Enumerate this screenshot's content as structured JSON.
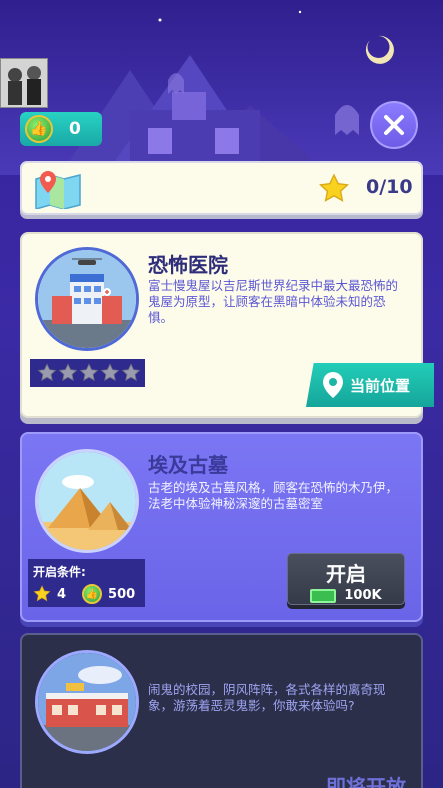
{
  "header": {
    "likes_value": "0",
    "progress_value": "0/10",
    "icons": {
      "likes": "thumbs-up-icon",
      "map": "map-icon",
      "star": "star-icon",
      "close": "close-icon"
    }
  },
  "levels": [
    {
      "title": "恐怖医院",
      "description": "富士慢鬼屋以吉尼斯世界纪录中最大最恐怖的鬼屋为原型，让顾客在黑暗中体验未知的恐惧。",
      "rating_stars": 5,
      "status_label": "当前位置"
    },
    {
      "title": "埃及古墓",
      "description": "古老的埃及古墓风格，顾客在恐怖的木乃伊，法老中体验神秘深邃的古墓密室",
      "unlock_label": "开启条件:",
      "unlock_stars": "4",
      "unlock_likes": "500",
      "open_label": "开启",
      "open_cost": "100K"
    },
    {
      "description": "闹鬼的校园，阴风阵阵，各式各样的离奇现象，游荡着恶灵鬼影，你敢来体验吗?",
      "status_label": "即将开放"
    }
  ],
  "colors": {
    "accent_teal": "#1fbfb0",
    "card_active": "#fdfbe9",
    "card_locked": "#6f69ec",
    "card_soon": "#2b2f49"
  }
}
